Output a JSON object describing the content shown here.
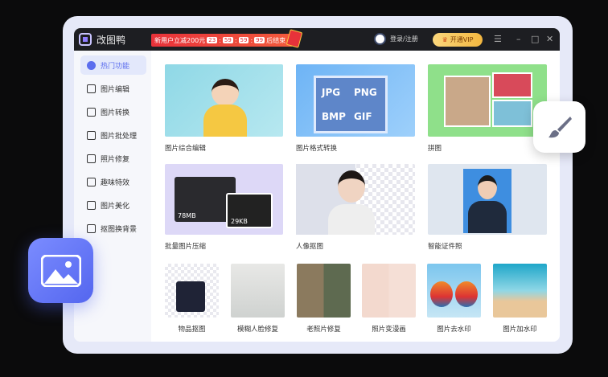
{
  "app": {
    "name": "改图鸭"
  },
  "promo": {
    "text": "新用户立减200元",
    "timer": [
      "23",
      "59",
      "59",
      "99"
    ],
    "suffix": "后结束"
  },
  "header": {
    "login": "登录/注册",
    "vip": "开通VIP",
    "menu": "☰",
    "minimize": "–",
    "maximize": "□",
    "close": "✕"
  },
  "sidebar": {
    "items": [
      {
        "label": "热门功能",
        "icon": "flame-icon",
        "active": true
      },
      {
        "label": "图片编辑",
        "icon": "image-edit-icon"
      },
      {
        "label": "图片转换",
        "icon": "convert-icon"
      },
      {
        "label": "图片批处理",
        "icon": "batch-icon"
      },
      {
        "label": "照片修复",
        "icon": "repair-icon"
      },
      {
        "label": "趣味特效",
        "icon": "effects-icon"
      },
      {
        "label": "图片美化",
        "icon": "beautify-icon"
      },
      {
        "label": "抠图换背景",
        "icon": "cutout-icon"
      }
    ]
  },
  "features": {
    "large": [
      {
        "label": "图片综合编辑"
      },
      {
        "label": "图片格式转换",
        "formats": [
          "JPG",
          "PNG",
          "BMP",
          "GIF"
        ]
      },
      {
        "label": "拼图"
      },
      {
        "label": "批量图片压缩",
        "sizes": [
          "78MB",
          "29KB"
        ]
      },
      {
        "label": "人像抠图"
      },
      {
        "label": "智能证件照"
      }
    ],
    "small": [
      {
        "label": "物品抠图"
      },
      {
        "label": "模糊人脸修复"
      },
      {
        "label": "老照片修复"
      },
      {
        "label": "照片变漫画"
      },
      {
        "label": "图片去水印"
      },
      {
        "label": "图片加水印"
      }
    ]
  },
  "colors": {
    "accent": "#5b6dee",
    "promo": "#e8323a",
    "vip": "#f3b740"
  }
}
